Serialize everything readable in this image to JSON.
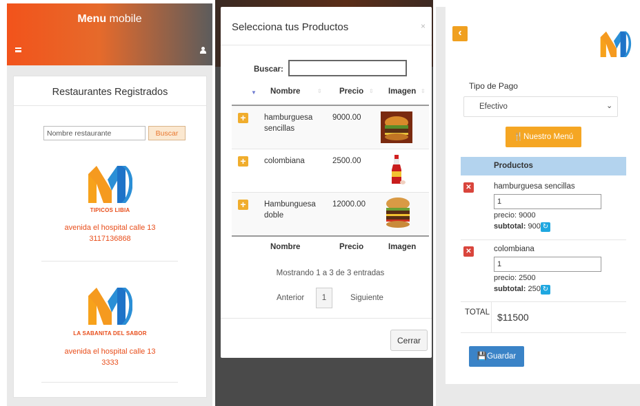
{
  "panel1": {
    "app_title_bold": "Menu",
    "app_title_rest": " mobile",
    "card_title": "Restaurantes Registrados",
    "search_placeholder": "Nombre restaurante",
    "search_button": "Buscar",
    "restaurants": [
      {
        "name": "TIPICOS LIBIA",
        "address": "avenida el hospital calle 13",
        "phone": "3117136868"
      },
      {
        "name": "LA SABANITA DEL SABOR",
        "address": "avenida el hospital calle 13",
        "phone": "3333"
      }
    ],
    "colors": {
      "accent": "#f2531b",
      "bar_end": "#5c5c5c",
      "link": "#e84d1a"
    }
  },
  "panel2": {
    "modal_title": "Selecciona tus Productos",
    "close_x": "×",
    "search_label": "Buscar:",
    "columns": [
      "Nombre",
      "Precio",
      "Imagen"
    ],
    "rows": [
      {
        "name_line1": "hamburguesa",
        "name_line2": "sencillas",
        "price": "9000.00",
        "image": "burger-photo"
      },
      {
        "name_line1": "colombiana",
        "name_line2": "",
        "price": "2500.00",
        "image": "soda-bottle-photo"
      },
      {
        "name_line1": "Hambunguesa",
        "name_line2": "doble",
        "price": "12000.00",
        "image": "double-burger-photo"
      }
    ],
    "info": "Mostrando 1 a 3 de 3 entradas",
    "prev": "Anterior",
    "page": "1",
    "next": "Siguiente",
    "close_button": "Cerrar"
  },
  "panel3": {
    "back_icon": "chevron-left-icon",
    "payment_label": "Tipo de Pago",
    "payment_value": "Efectivo",
    "menu_button": "Nuestro Menú",
    "products_header": "Productos",
    "items": [
      {
        "name": "hamburguesa sencillas",
        "qty": "1",
        "price_label": "precio:",
        "price": "9000",
        "subtotal_label": "subtotal:",
        "subtotal": "9000"
      },
      {
        "name": "colombiana",
        "qty": "1",
        "price_label": "precio:",
        "price": "2500",
        "subtotal_label": "subtotal:",
        "subtotal": "2500"
      }
    ],
    "total_label": "TOTAL",
    "total_value": "$11500",
    "save_button": "Guardar"
  }
}
